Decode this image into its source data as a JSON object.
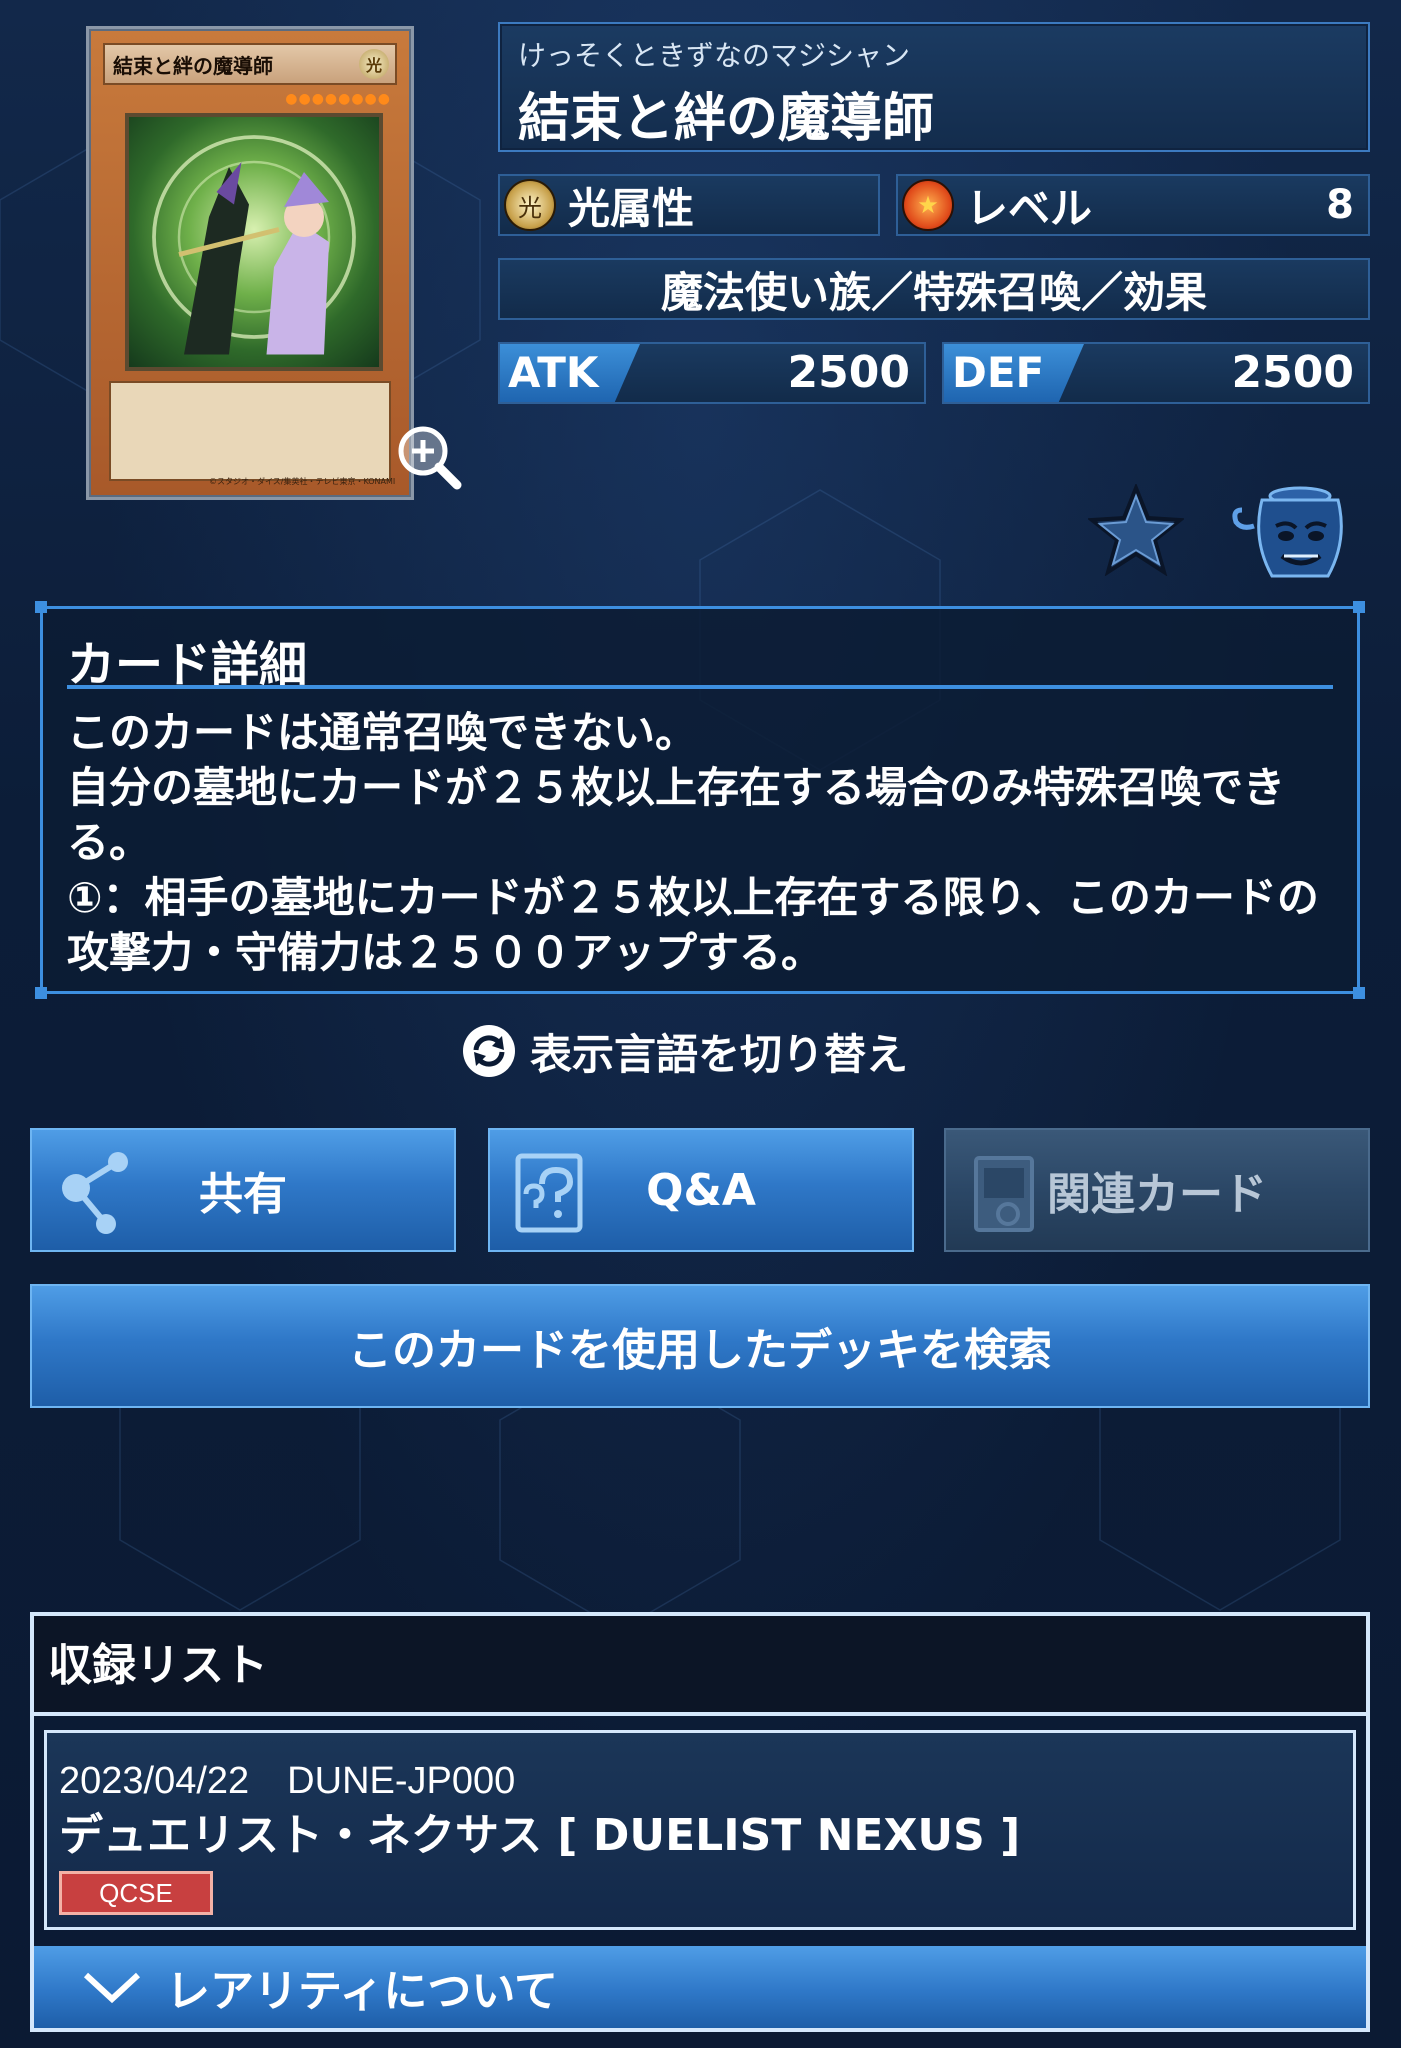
{
  "card": {
    "image_name": "結束と絆の魔導師",
    "image_attr": "光",
    "image_stars": "●●●●●●●●",
    "copyright": "©スタジオ・ダイス/集英社・テレビ東京・KONAMI",
    "ruby": "けっそくときずなのマジシャン",
    "name": "結束と絆の魔導師",
    "attribute": "光属性",
    "attribute_icon_glyph": "光",
    "level_label": "レベル",
    "level_value": "8",
    "type": "魔法使い族／特殊召喚／効果",
    "atk_label": "ATK",
    "atk_value": "2500",
    "def_label": "DEF",
    "def_value": "2500"
  },
  "icons": {
    "zoom": "zoom-in-icon",
    "favorite": "star-icon",
    "pot": "pot-of-greed-icon",
    "switch": "refresh-icon",
    "share": "share-icon",
    "qa": "qa-icon",
    "related": "related-card-icon",
    "chevron": "chevron-down-icon"
  },
  "detail": {
    "title": "カード詳細",
    "text": "このカードは通常召喚できない。\n自分の墓地にカードが２５枚以上存在する場合のみ特殊召喚できる。\n①：相手の墓地にカードが２５枚以上存在する限り、このカードの攻撃力・守備力は２５００アップする。"
  },
  "switch_language": "表示言語を切り替え",
  "buttons": {
    "share": "共有",
    "qa": "Q&A",
    "related": "関連カード",
    "deck_search": "このカードを使用したデッキを検索"
  },
  "release_list": {
    "title": "収録リスト",
    "items": [
      {
        "date": "2023/04/22",
        "code": "DUNE-JP000",
        "date_code": "2023/04/22　DUNE-JP000",
        "pack": "デュエリスト・ネクサス [ DUELIST NEXUS ]",
        "rarity": "QCSE"
      }
    ],
    "rarity_toggle": "レアリティについて"
  },
  "colors": {
    "accent": "#3d8fe0",
    "button": "#2f78c8",
    "rarity_badge": "#c84040",
    "background": "#0b1a33"
  }
}
